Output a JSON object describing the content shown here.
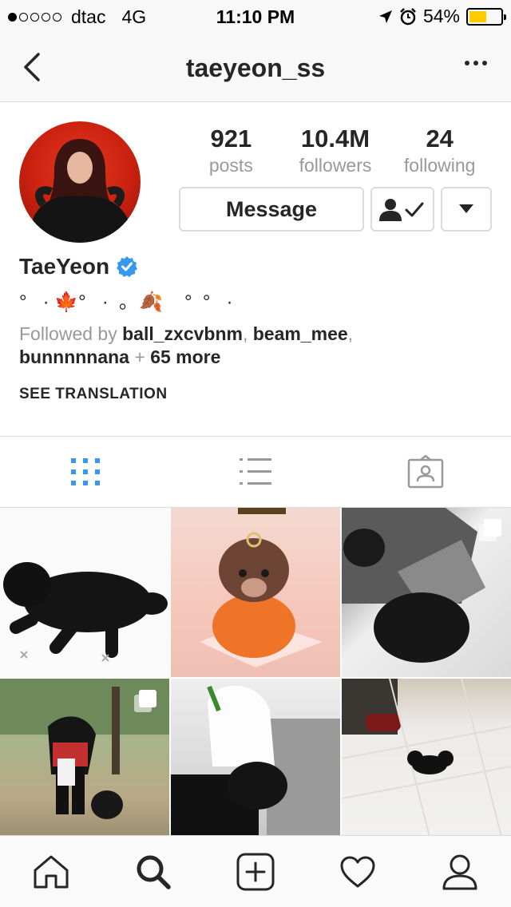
{
  "status_bar": {
    "carrier": "dtac",
    "network": "4G",
    "time": "11:10 PM",
    "battery": "54%",
    "signal_dots": [
      true,
      false,
      false,
      false,
      false
    ]
  },
  "nav": {
    "title": "taeyeon_ss"
  },
  "profile": {
    "stats": [
      {
        "value": "921",
        "label": "posts"
      },
      {
        "value": "10.4M",
        "label": "followers"
      },
      {
        "value": "24",
        "label": "following"
      }
    ],
    "message_label": "Message",
    "name": "TaeYeon",
    "bio": "°   · 🍁°   ·  ｡  🍂    °  °   ·",
    "followed_prefix": "Followed by ",
    "followed_user_1": "ball_zxcvbnm",
    "followed_sep_1": ", ",
    "followed_user_2": "beam_mee",
    "followed_sep_2": ",",
    "followed_user_3": "bunnnnnana",
    "followed_plus": " + ",
    "followed_more": "65 more",
    "see_translation": "SEE TRANSLATION"
  },
  "colors": {
    "accent_blue": "#3897f0",
    "border": "#dbdbdb",
    "muted": "#999999",
    "text": "#262626"
  },
  "icons": {
    "back": "chevron-left-icon",
    "more": "more-horizontal-icon",
    "verified": "verified-badge-icon",
    "following": "person-check-icon",
    "dropdown": "caret-down-icon",
    "grid_tab": "grid-icon",
    "list_tab": "list-icon",
    "tagged_tab": "tagged-photos-icon",
    "home": "home-icon",
    "search": "search-icon",
    "add": "add-post-icon",
    "activity": "heart-icon",
    "profile": "profile-icon"
  }
}
